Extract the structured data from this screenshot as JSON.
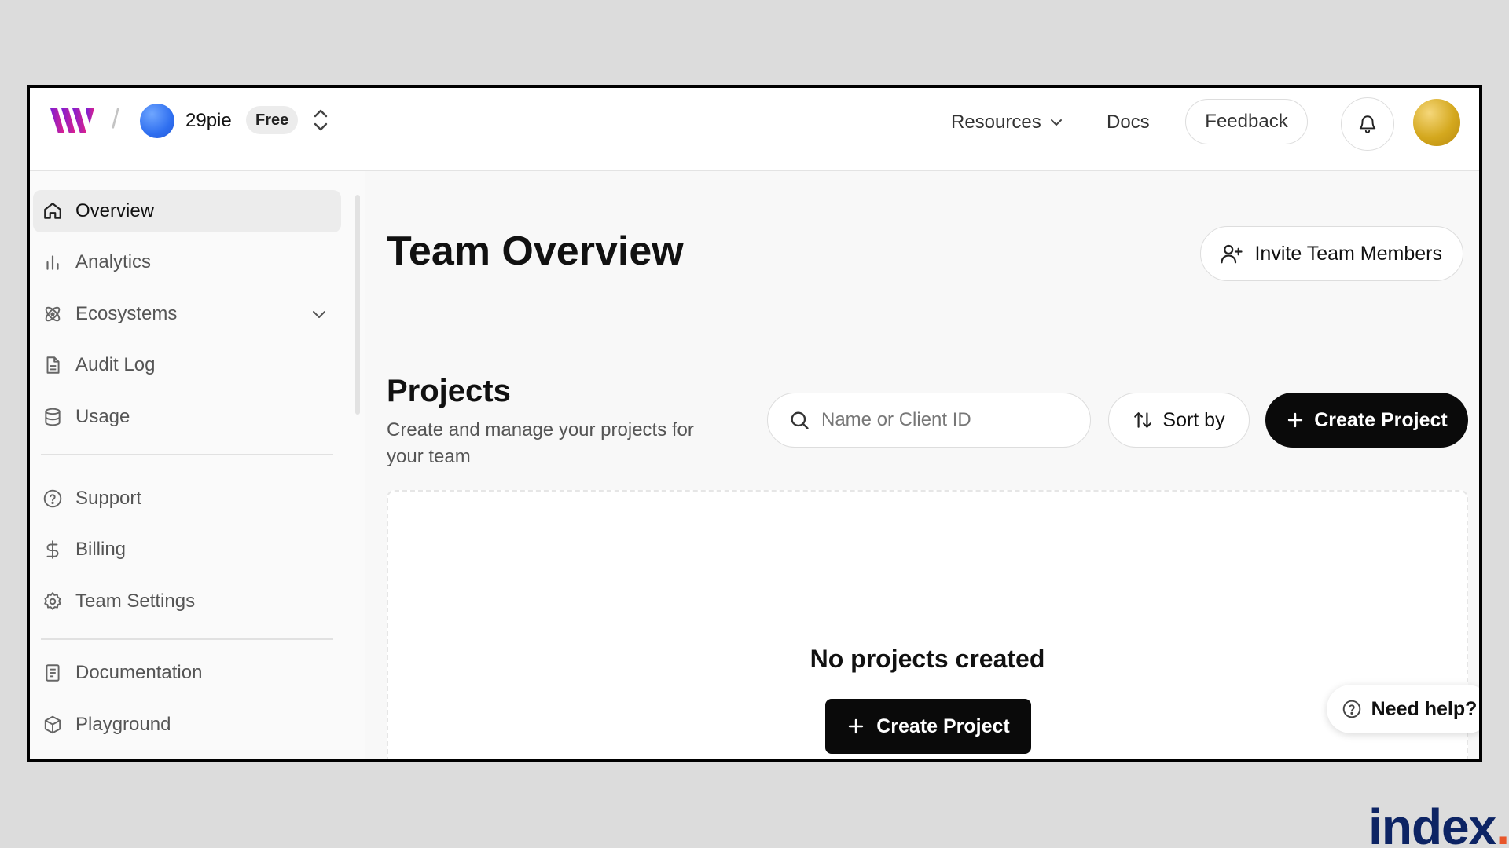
{
  "header": {
    "team_name": "29pie",
    "plan_badge": "Free",
    "nav_resources": "Resources",
    "nav_docs": "Docs",
    "feedback_label": "Feedback"
  },
  "sidebar": {
    "items": [
      {
        "label": "Overview",
        "icon": "home-icon",
        "active": true
      },
      {
        "label": "Analytics",
        "icon": "bar-chart-icon"
      },
      {
        "label": "Ecosystems",
        "icon": "atom-icon",
        "expandable": true
      },
      {
        "label": "Audit Log",
        "icon": "file-text-icon"
      },
      {
        "label": "Usage",
        "icon": "database-icon"
      },
      {
        "label": "Support",
        "icon": "help-circle-icon"
      },
      {
        "label": "Billing",
        "icon": "dollar-icon"
      },
      {
        "label": "Team Settings",
        "icon": "gear-icon"
      },
      {
        "label": "Documentation",
        "icon": "book-icon"
      },
      {
        "label": "Playground",
        "icon": "box-icon"
      }
    ]
  },
  "main": {
    "page_title": "Team Overview",
    "invite_label": "Invite Team Members",
    "projects_title": "Projects",
    "projects_subtitle": "Create and manage your projects for your team",
    "search_placeholder": "Name or Client ID",
    "sort_label": "Sort by",
    "create_label": "Create Project",
    "empty_title": "No projects created",
    "empty_create_label": "Create Project",
    "help_label": "Need help?"
  },
  "watermark": {
    "text": "index",
    "dot": "."
  },
  "colors": {
    "accent_dark": "#0a0a0a",
    "logo_gradient": [
      "#7a1fd6",
      "#e0208a"
    ],
    "team_avatar": "#2f6ff0",
    "user_avatar": "#d4a81e",
    "watermark": "#0d2464"
  }
}
